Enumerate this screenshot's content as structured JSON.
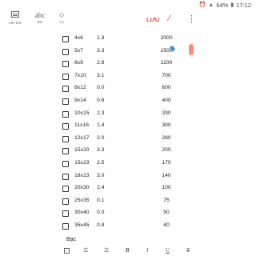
{
  "status_bar": {
    "battery": "64%",
    "time": "17:12"
  },
  "toolbar": {
    "van_ban_label": "Văn bản",
    "abc_glyph": "abc",
    "abc_sub": "Bút",
    "co_glyph": "💎",
    "co_sub": "Cọ",
    "save_label": "LƯU",
    "clip_icon": "⊘",
    "more_icon": "⋮"
  },
  "rows": [
    {
      "size": "4x6",
      "price": "1.3",
      "qty": "2000"
    },
    {
      "size": "5x7",
      "price": "3.3",
      "qty": "1500"
    },
    {
      "size": "6x9",
      "price": "2.8",
      "qty": "1100"
    },
    {
      "size": "7x10",
      "price": "3.1",
      "qty": "700"
    },
    {
      "size": "8x12",
      "price": "0.0",
      "qty": "600"
    },
    {
      "size": "9x14",
      "price": "0.6",
      "qty": "400"
    },
    {
      "size": "10x15",
      "price": "2.3",
      "qty": "330"
    },
    {
      "size": "11x16",
      "price": "1.4",
      "qty": "300"
    },
    {
      "size": "12x17",
      "price": "2.0",
      "qty": "280"
    },
    {
      "size": "15x20",
      "price": "3.3",
      "qty": "200"
    },
    {
      "size": "15x23",
      "price": "2.5",
      "qty": "170"
    },
    {
      "size": "18x23",
      "price": "3.0",
      "qty": "140"
    },
    {
      "size": "20x30",
      "price": "2.4",
      "qty": "100"
    },
    {
      "size": "25x35",
      "price": "0.1",
      "qty": "75"
    },
    {
      "size": "30x40",
      "price": "0.0",
      "qty": "50"
    },
    {
      "size": "35x45",
      "price": "0.8",
      "qty": "40"
    }
  ],
  "footer_text": "Bạc"
}
